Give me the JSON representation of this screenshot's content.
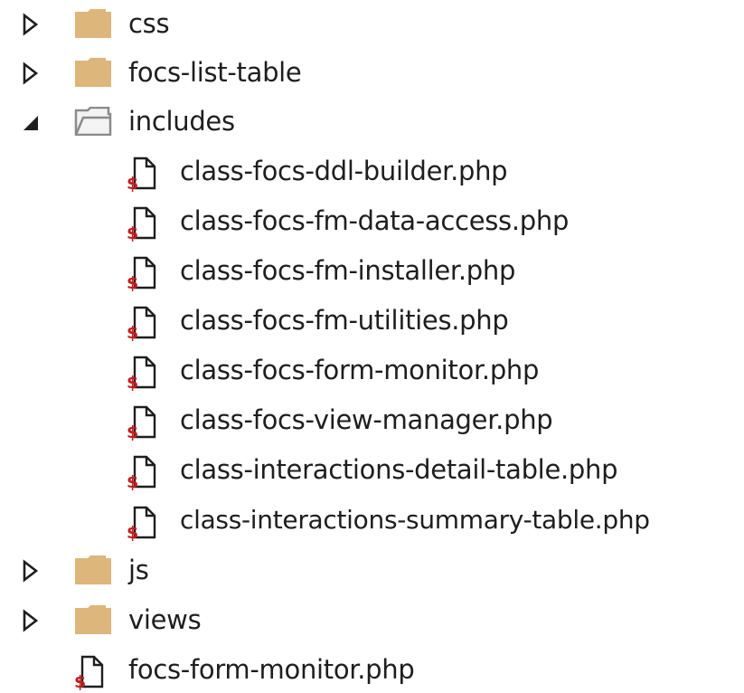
{
  "tree": {
    "items": [
      {
        "label": "css",
        "type": "folder",
        "state": "collapsed"
      },
      {
        "label": "focs-list-table",
        "type": "folder",
        "state": "collapsed"
      },
      {
        "label": "includes",
        "type": "folder",
        "state": "expanded"
      },
      {
        "label": "class-focs-ddl-builder.php",
        "type": "php-file",
        "level": 2
      },
      {
        "label": "class-focs-fm-data-access.php",
        "type": "php-file",
        "level": 2
      },
      {
        "label": "class-focs-fm-installer.php",
        "type": "php-file",
        "level": 2
      },
      {
        "label": "class-focs-fm-utilities.php",
        "type": "php-file",
        "level": 2
      },
      {
        "label": "class-focs-form-monitor.php",
        "type": "php-file",
        "level": 2
      },
      {
        "label": "class-focs-view-manager.php",
        "type": "php-file",
        "level": 2
      },
      {
        "label": "class-interactions-detail-table.php",
        "type": "php-file",
        "level": 2
      },
      {
        "label": "class-interactions-summary-table.php",
        "type": "php-file",
        "level": 2
      },
      {
        "label": "js",
        "type": "folder",
        "state": "collapsed"
      },
      {
        "label": "views",
        "type": "folder",
        "state": "collapsed"
      },
      {
        "label": "focs-form-monitor.php",
        "type": "php-file",
        "level": 1
      }
    ],
    "file_badge": "$",
    "colors": {
      "folder": "#dcb67a",
      "folder_open_fill": "#f3f3f3",
      "folder_open_stroke": "#8a8a8a",
      "php_badge": "#c31c1c",
      "arrow": "#1e1e1e"
    }
  }
}
